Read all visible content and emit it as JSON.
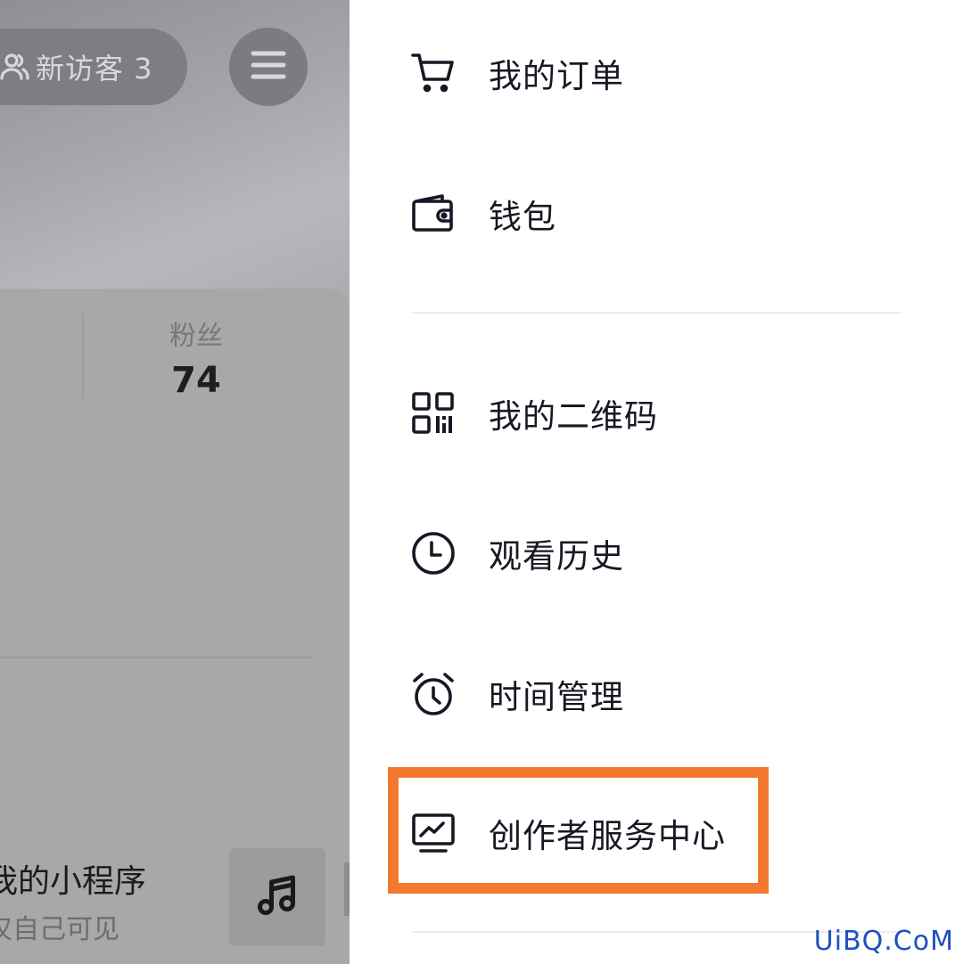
{
  "profile": {
    "visitor_label": "新访客 3",
    "stats": {
      "label": "粉丝",
      "value": "74"
    },
    "mini_program": {
      "title": "我的小程序",
      "subtitle": "仅自己可见"
    }
  },
  "drawer": {
    "items": [
      {
        "label": "我的订单",
        "icon": "cart-icon"
      },
      {
        "label": "钱包",
        "icon": "wallet-icon"
      },
      {
        "label": "我的二维码",
        "icon": "qr-code-icon"
      },
      {
        "label": "观看历史",
        "icon": "clock-icon"
      },
      {
        "label": "时间管理",
        "icon": "alarm-clock-icon"
      },
      {
        "label": "创作者服务中心",
        "icon": "creator-chart-icon"
      }
    ],
    "highlighted_item": "创作者服务中心",
    "highlight_color": "#f4792f"
  },
  "watermark": "UiBQ.CoM"
}
